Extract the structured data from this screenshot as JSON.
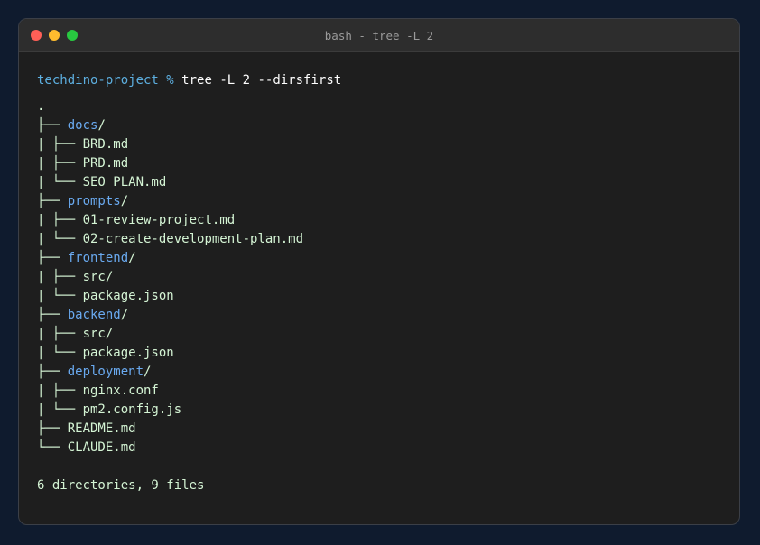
{
  "window": {
    "title": "bash - tree -L 2"
  },
  "prompt": {
    "directory": "techdino-project",
    "symbol": "%",
    "command": "tree -L 2 --dirsfirst"
  },
  "tree": [
    {
      "prefix": ".",
      "name": "",
      "suffix": "",
      "is_dir": false
    },
    {
      "prefix": "├── ",
      "name": "docs",
      "suffix": "/",
      "is_dir": true
    },
    {
      "prefix": "| ├── ",
      "name": "BRD.md",
      "suffix": "",
      "is_dir": false
    },
    {
      "prefix": "| ├── ",
      "name": "PRD.md",
      "suffix": "",
      "is_dir": false
    },
    {
      "prefix": "| └── ",
      "name": "SEO_PLAN.md",
      "suffix": "",
      "is_dir": false
    },
    {
      "prefix": "├── ",
      "name": "prompts",
      "suffix": "/",
      "is_dir": true
    },
    {
      "prefix": "| ├── ",
      "name": "01-review-project.md",
      "suffix": "",
      "is_dir": false
    },
    {
      "prefix": "| └── ",
      "name": "02-create-development-plan.md",
      "suffix": "",
      "is_dir": false
    },
    {
      "prefix": "├── ",
      "name": "frontend",
      "suffix": "/",
      "is_dir": true
    },
    {
      "prefix": "| ├── ",
      "name": "src/",
      "suffix": "",
      "is_dir": false
    },
    {
      "prefix": "| └── ",
      "name": "package.json",
      "suffix": "",
      "is_dir": false
    },
    {
      "prefix": "├── ",
      "name": "backend",
      "suffix": "/",
      "is_dir": true
    },
    {
      "prefix": "| ├── ",
      "name": "src/",
      "suffix": "",
      "is_dir": false
    },
    {
      "prefix": "| └── ",
      "name": "package.json",
      "suffix": "",
      "is_dir": false
    },
    {
      "prefix": "├── ",
      "name": "deployment",
      "suffix": "/",
      "is_dir": true
    },
    {
      "prefix": "| ├── ",
      "name": "nginx.conf",
      "suffix": "",
      "is_dir": false
    },
    {
      "prefix": "| └── ",
      "name": "pm2.config.js",
      "suffix": "",
      "is_dir": false
    },
    {
      "prefix": "├── ",
      "name": "README.md",
      "suffix": "",
      "is_dir": false
    },
    {
      "prefix": "└── ",
      "name": "CLAUDE.md",
      "suffix": "",
      "is_dir": false
    }
  ],
  "summary": "6 directories, 9 files",
  "colors": {
    "background": "#1e1e1e",
    "prompt": "#5dafe0",
    "directory": "#6aaaf0",
    "text": "#d4f4d4"
  },
  "icons": {
    "close": "close-dot",
    "minimize": "minimize-dot",
    "zoom": "zoom-dot"
  }
}
